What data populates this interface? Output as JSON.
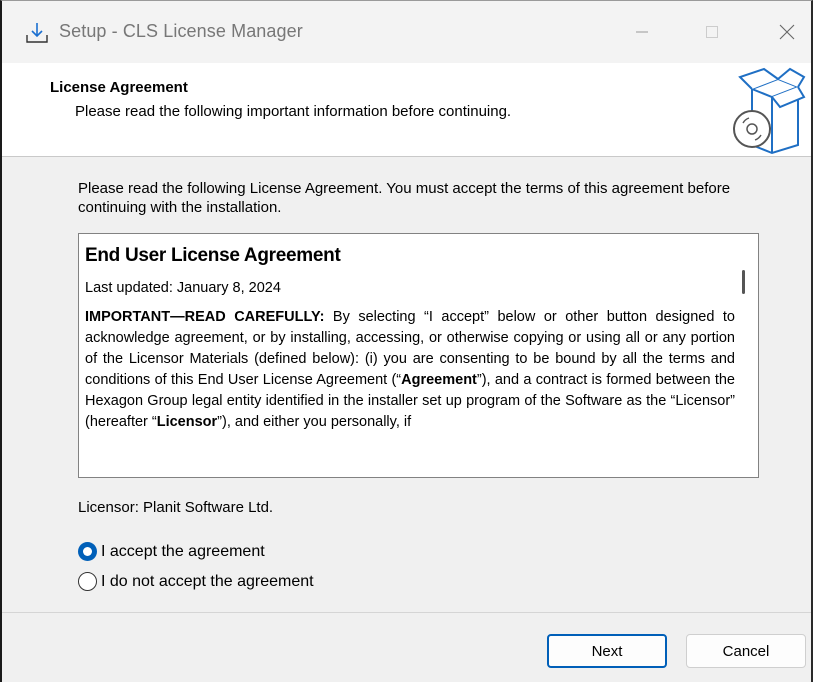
{
  "window": {
    "title": "Setup - CLS License Manager"
  },
  "icons": {
    "app": "setup-download-icon",
    "header": "box-disc-icon",
    "minimize": "minimize-icon",
    "maximize": "maximize-icon",
    "close": "close-icon"
  },
  "header": {
    "title": "License Agreement",
    "subtitle": "Please read the following important information before continuing."
  },
  "intro_text": "Please read the following License Agreement. You must accept the terms of this agreement before continuing with the installation.",
  "license": {
    "heading": "End User License Agreement",
    "last_updated": "Last updated: January 8, 2024",
    "para_lead": "IMPORTANT—READ CAREFULLY:",
    "para_1": " By selecting “I accept” below or other button designed to acknowledge agreement, or by installing, accessing, or otherwise copying or using all or any portion of the Licensor Materials (defined below): (i) you are consenting to be bound by all the terms and conditions of this End User License Agreement (“",
    "para_agreement": "Agreement",
    "para_2": "”), and a contract is formed between the Hexagon Group legal entity identified in the installer set up program of the Software as the “Licensor” (hereafter “",
    "para_licensor": "Licensor",
    "para_3": "”), and either you personally, if"
  },
  "licensor_line": "Licensor: Planit Software Ltd.",
  "options": {
    "accept": "I accept the agreement",
    "decline": "I do not accept the agreement",
    "selected": "accept"
  },
  "buttons": {
    "next": "Next",
    "cancel": "Cancel"
  },
  "colors": {
    "accent": "#005fb8"
  }
}
